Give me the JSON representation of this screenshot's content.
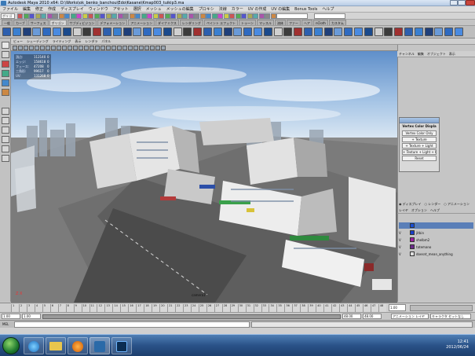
{
  "window": {
    "title": "Autodesk Maya 2010 x64: D:\\Works\\ok_benko_banchou\\Edo\\Kasane\\Kmap003_tuikip3.ma"
  },
  "menubar": [
    "ファイル",
    "編集",
    "修正",
    "作成",
    "ディスプレイ",
    "ウィンドウ",
    "アセット",
    "選択",
    "メッシュ",
    "メッシュの編集",
    "プロキシ",
    "法線",
    "カラー",
    "UV の作成",
    "UV の編集",
    "Bonus Tools",
    "ヘルプ"
  ],
  "statusline": {
    "mode": "ポリゴン",
    "field_x": "",
    "field_y": ""
  },
  "shelf_tabs": [
    "一般",
    "カーブ",
    "サーフェス",
    "ポリゴン",
    "サブディビジョン",
    "デフォメーション",
    "アニメーション",
    "ダイナミクス",
    "レンダリング",
    "ペイント エフェクト",
    "トゥーン",
    "マッスル",
    "流体",
    "ファー",
    "ヘア",
    "nCloth",
    "カスタム"
  ],
  "shelf_active_tab": "ポリゴン",
  "panel_menu": [
    "ビュー",
    "シェーディング",
    "ライティング",
    "表示",
    "レンダラ",
    "パネル"
  ],
  "hud": [
    {
      "label": "頂点:",
      "value": "112140",
      "extra": "0"
    },
    {
      "label": "エッジ:",
      "value": "158618",
      "extra": "0"
    },
    {
      "label": "フェース:",
      "value": "47208",
      "extra": "0"
    },
    {
      "label": "三角形:",
      "value": "99617",
      "extra": "0"
    },
    {
      "label": "UV:",
      "value": "131268",
      "extra": "0"
    }
  ],
  "viewport": {
    "camera_label": "camera1",
    "axis_label": "Z X"
  },
  "vertex_color_panel": {
    "title": "Vertex Color Displa",
    "buttons": [
      "Vertex Color Only",
      "+ Texture",
      "+ Texture + Light",
      "+ Texture + Light + HQ",
      "Reset"
    ]
  },
  "channel_box_menu": [
    "チャンネル",
    "編集",
    "オブジェクト",
    "表示"
  ],
  "layer_editor": {
    "radios": [
      "ディスプレイ",
      "レンダー",
      "アニメーション"
    ],
    "menu": [
      "レイヤ",
      "オプション",
      "ヘルプ"
    ],
    "layers": [
      {
        "vis": "",
        "type": "",
        "name": "",
        "color": "#1a4fd6",
        "selected": true
      },
      {
        "vis": "V",
        "type": "",
        "name": "jitbin",
        "color": "#1a3fc8",
        "selected": false
      },
      {
        "vis": "V",
        "type": "",
        "name": "shelbm2",
        "color": "#a020a0",
        "selected": false
      },
      {
        "vis": "V",
        "type": "",
        "name": "tatemano",
        "color": "#6b2a8a",
        "selected": false
      },
      {
        "vis": "V",
        "type": "",
        "name": "doesnt_mean_anything",
        "color": "#e0e0e0",
        "selected": false
      }
    ]
  },
  "timeline": {
    "ticks": [
      "1",
      "2",
      "3",
      "4",
      "5",
      "6",
      "7",
      "8",
      "9",
      "10",
      "11",
      "12",
      "13",
      "14",
      "15",
      "16",
      "17",
      "18",
      "19",
      "20",
      "21",
      "22",
      "23",
      "24",
      "25",
      "26",
      "27",
      "28",
      "29",
      "30",
      "31",
      "32",
      "33",
      "34",
      "35",
      "36",
      "37",
      "38",
      "39",
      "40",
      "41",
      "42",
      "43",
      "44",
      "45",
      "46",
      "47",
      "48"
    ],
    "current_frame": "1.00"
  },
  "range": {
    "start": "1.00",
    "inner_start": "1.00",
    "inner_end": "48.00",
    "end": "48.00",
    "anim_layer": "アニメーション レイヤ",
    "char_set": "キャラクタ セットなし"
  },
  "cmdline": {
    "label": "MEL"
  },
  "taskbar": {
    "time": "12:41",
    "date": "2012/06/24"
  }
}
